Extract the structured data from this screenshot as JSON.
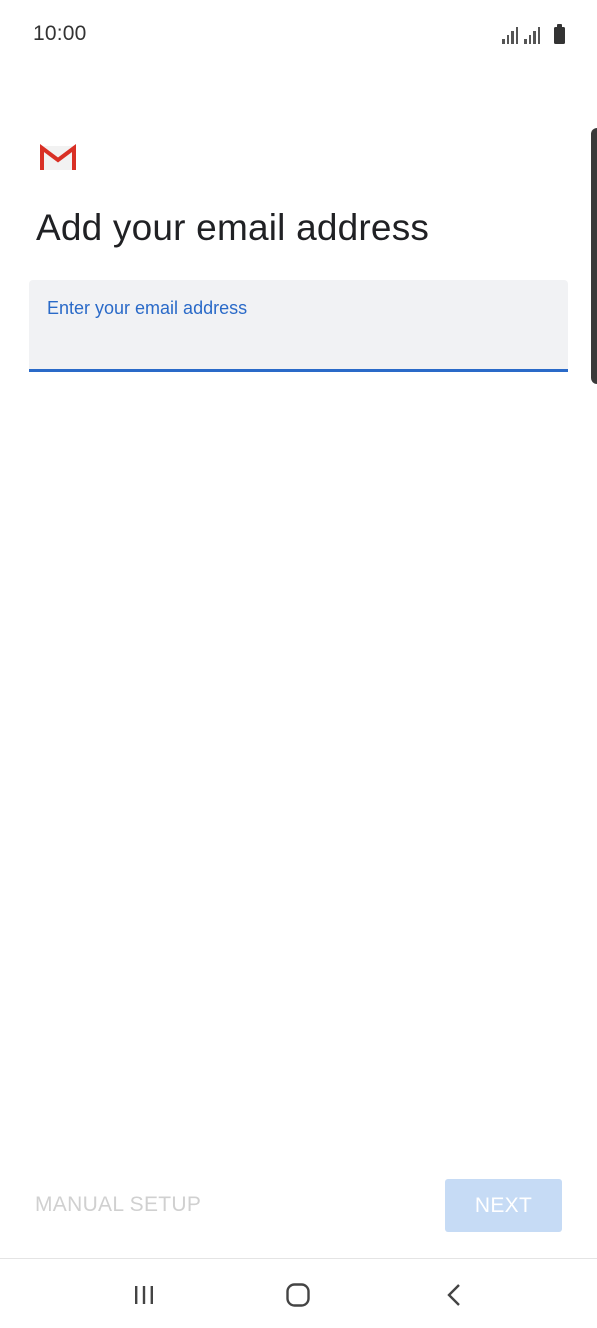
{
  "status_bar": {
    "time": "10:00"
  },
  "app": {
    "logo_icon": "gmail-logo-icon",
    "brand_color": "#d93025"
  },
  "page": {
    "title": "Add your email address"
  },
  "email_field": {
    "label": "Enter your email address",
    "value": "",
    "accent_color": "#2a6ac8"
  },
  "actions": {
    "manual_setup_label": "MANUAL SETUP",
    "next_label": "NEXT"
  },
  "nav_bar": {
    "recents_icon": "recents-icon",
    "home_icon": "home-icon",
    "back_icon": "back-icon"
  }
}
